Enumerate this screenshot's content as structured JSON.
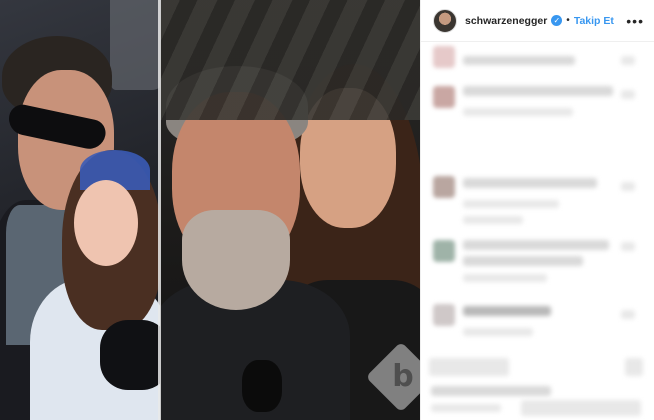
{
  "post": {
    "username": "schwarzenegger",
    "verified_icon": "check-icon",
    "separator": "•",
    "follow_label": "Takip Et",
    "more_icon": "ellipsis-icon"
  },
  "watermark": {
    "letter": "b"
  },
  "colors": {
    "follow": "#3897f0",
    "verified": "#3897f0",
    "text": "#262626"
  }
}
